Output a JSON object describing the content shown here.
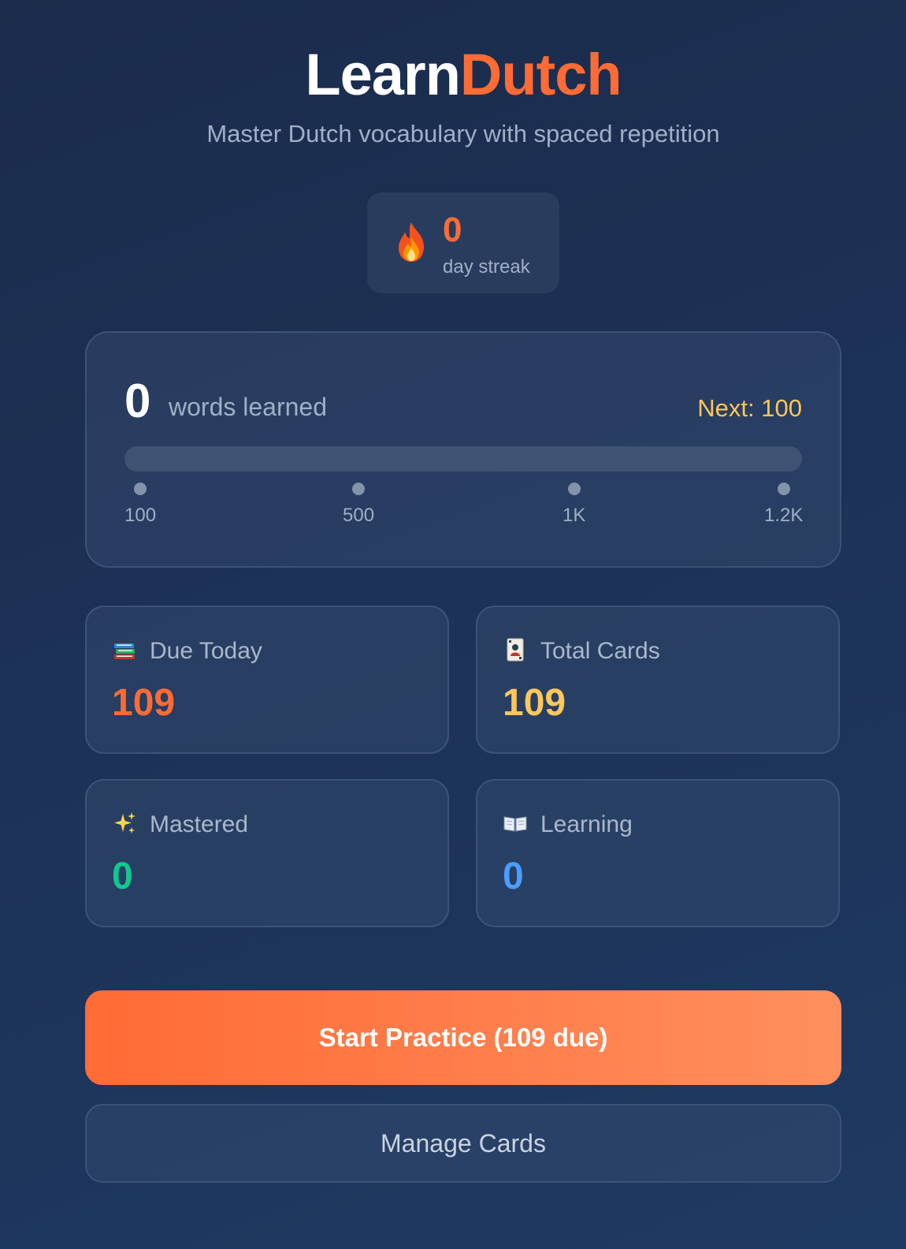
{
  "header": {
    "logo_part1": "Learn",
    "logo_part2": "Dutch",
    "subtitle": "Master Dutch vocabulary with spaced repetition"
  },
  "streak": {
    "icon": "fire-icon",
    "count": "0",
    "label": "day streak"
  },
  "progress": {
    "count": "0",
    "label": "words learned",
    "next": "Next: 100",
    "fraction": 0,
    "milestones": [
      "100",
      "500",
      "1K",
      "1.2K"
    ]
  },
  "stats": {
    "due_today": {
      "icon": "books-icon",
      "label": "Due Today",
      "value": "109"
    },
    "total_cards": {
      "icon": "playing-card-icon",
      "label": "Total Cards",
      "value": "109"
    },
    "mastered": {
      "icon": "sparkles-icon",
      "label": "Mastered",
      "value": "0"
    },
    "learning": {
      "icon": "open-book-icon",
      "label": "Learning",
      "value": "0"
    }
  },
  "actions": {
    "start_practice": "Start Practice (109 due)",
    "manage_cards": "Manage Cards"
  },
  "colors": {
    "accent": "#ff6b35",
    "gold": "#ffc75a",
    "green": "#10c98f",
    "blue": "#4a9eff",
    "background": "#1d3358"
  }
}
